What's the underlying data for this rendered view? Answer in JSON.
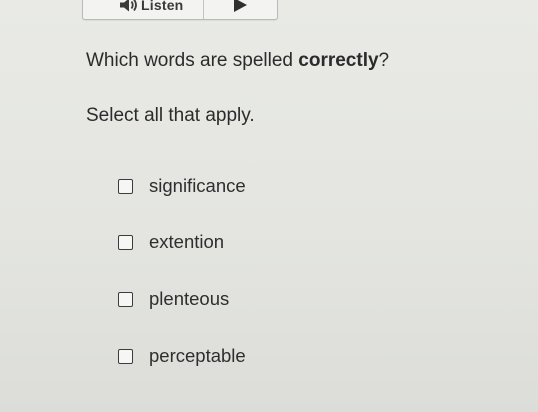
{
  "listen_bar": {
    "label": "Listen",
    "speaker_icon": "speaker-icon",
    "play_icon": "play-icon"
  },
  "question": {
    "text_before": "Which words are spelled ",
    "emphasis": "correctly",
    "text_after": "?",
    "instruction": "Select all that apply."
  },
  "options": [
    {
      "label": "significance",
      "checked": false
    },
    {
      "label": "extention",
      "checked": false
    },
    {
      "label": "plenteous",
      "checked": false
    },
    {
      "label": "perceptable",
      "checked": false
    }
  ]
}
